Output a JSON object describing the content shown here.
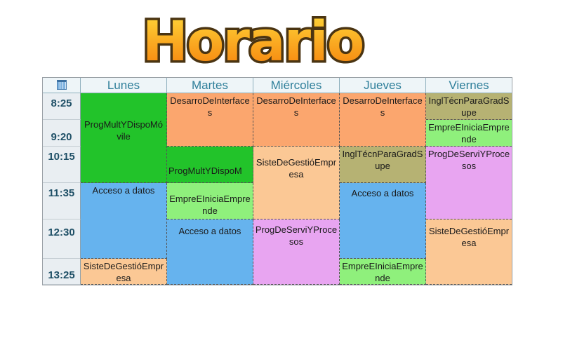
{
  "title": "Horario",
  "days": [
    "Lunes",
    "Martes",
    "Miércoles",
    "Jueves",
    "Viernes"
  ],
  "times": [
    "8:25",
    "9:20",
    "10:15",
    "11:35",
    "12:30",
    "13:25"
  ],
  "colors": {
    "progmult": "#22c32a",
    "desarrollo": "#fba66e",
    "acceso": "#66b3ee",
    "empre": "#8ff07c",
    "ingles": "#b6b273",
    "progservi": "#e8a5f1",
    "sistegestion": "#fbc895"
  },
  "schedule": {
    "lunes": {
      "progmult": "ProgMultYDispoMóvile",
      "acceso": "Acceso a datos",
      "siste": "SisteDeGestióEmpresa"
    },
    "martes": {
      "desarrollo": "DesarroDeInterfaces",
      "progmult": "ProgMultYDispoM",
      "empre": "EmpreEIniciaEmprende",
      "acceso": "Acceso a datos"
    },
    "miercoles": {
      "desarrollo": "DesarroDeInterfaces",
      "siste": "SisteDeGestióEmpresa",
      "progservi": "ProgDeServiYProcesos"
    },
    "jueves": {
      "desarrollo": "DesarroDeInterfaces",
      "ingles": "InglTécnParaGradSupe",
      "acceso": "Acceso a datos",
      "empre": "EmpreEIniciaEmprende"
    },
    "viernes": {
      "ingles": "InglTécnParaGradSupe",
      "empre": "EmpreEIniciaEmprende",
      "progservi": "ProgDeServiYProcesos",
      "siste": "SisteDeGestióEmpresa"
    }
  }
}
